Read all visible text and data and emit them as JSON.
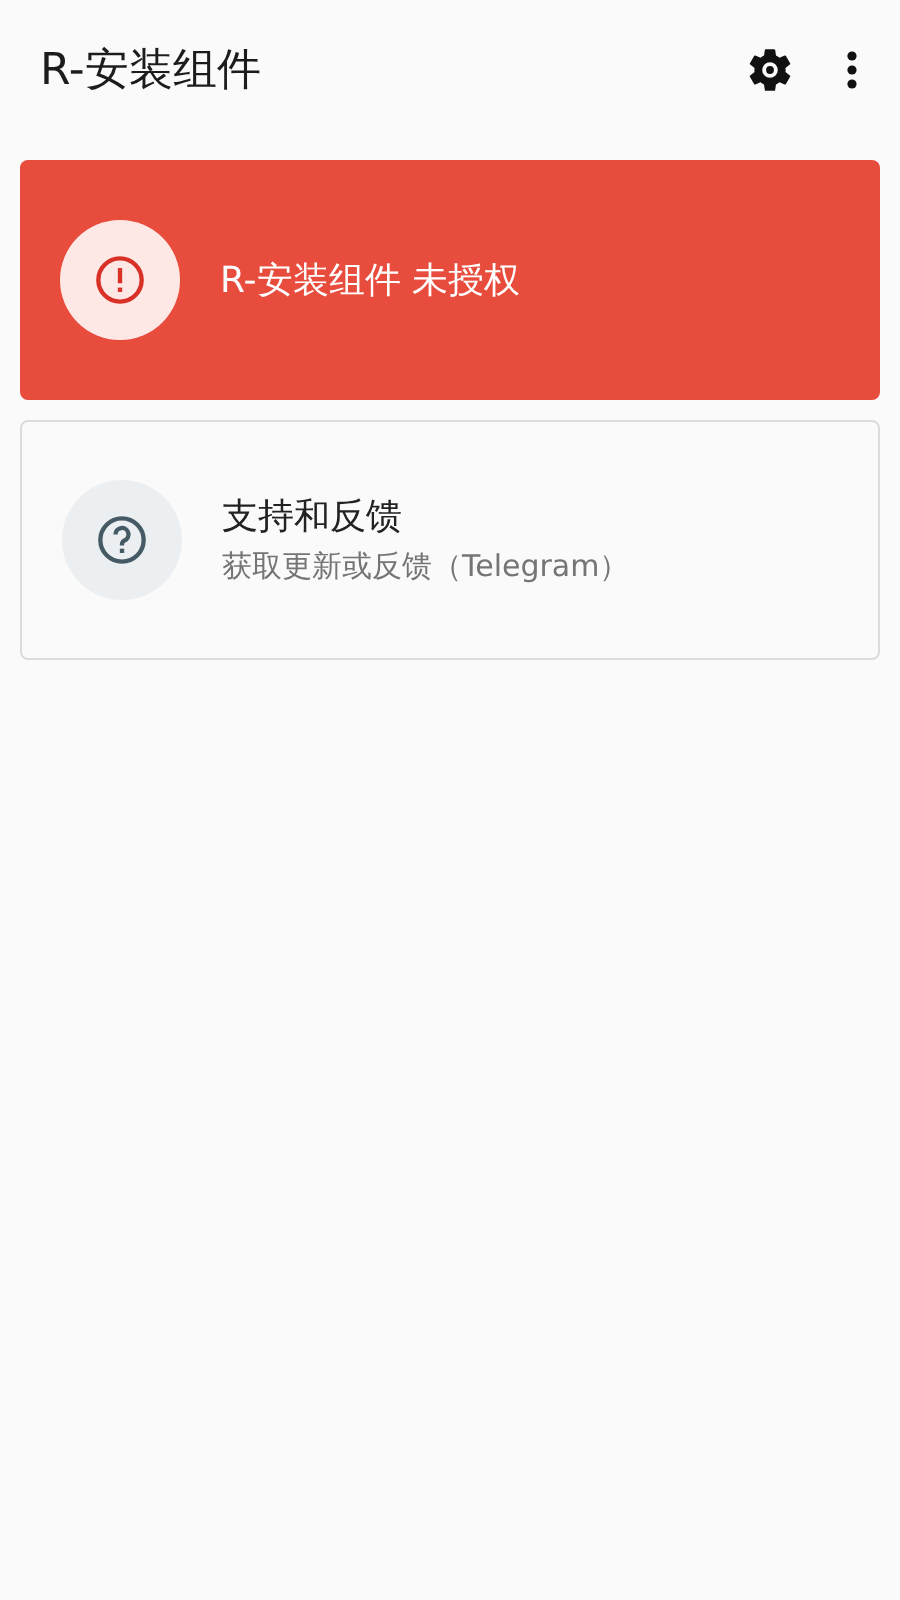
{
  "app_bar": {
    "title": "R-安装组件"
  },
  "cards": [
    {
      "kind": "warning",
      "title": "R-安装组件 未授权"
    },
    {
      "kind": "info",
      "title": "支持和反馈",
      "subtitle": "获取更新或反馈（Telegram）"
    }
  ]
}
